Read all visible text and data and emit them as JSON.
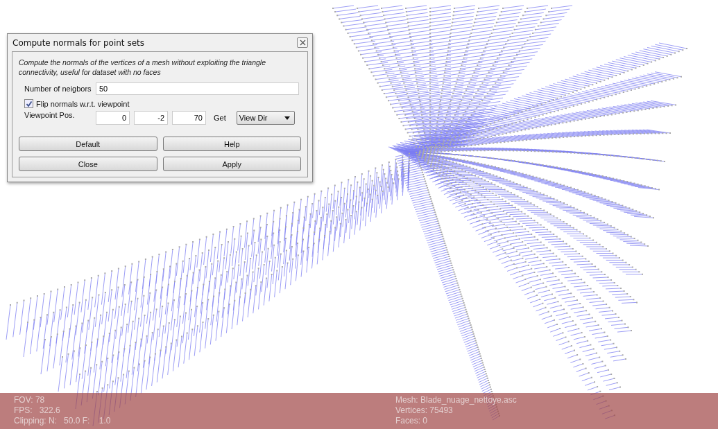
{
  "dialog": {
    "title": "Compute normals for point sets",
    "description": "Compute the normals of the vertices of a mesh without exploiting the triangle connectivity, useful for dataset with no faces",
    "neighbors": {
      "label": "Number of neigbors",
      "value": "50"
    },
    "flip": {
      "label": "Flip normals w.r.t. viewpoint",
      "checked": true
    },
    "viewpoint": {
      "label": "Viewpoint Pos.",
      "values": [
        "0",
        "-2",
        "70"
      ],
      "get_label": "Get",
      "dropdown": "View Dir"
    },
    "buttons": [
      "Default",
      "Help",
      "Close",
      "Apply"
    ]
  },
  "info_overlay": {
    "left": [
      "FOV: 78",
      "FPS:   322.6",
      "Clipping: N:   50.0 F:    1.0"
    ],
    "right": [
      "Mesh: Blade_nuage_nettoye.asc",
      "Vertices: 75493",
      "Faces: 0"
    ]
  }
}
